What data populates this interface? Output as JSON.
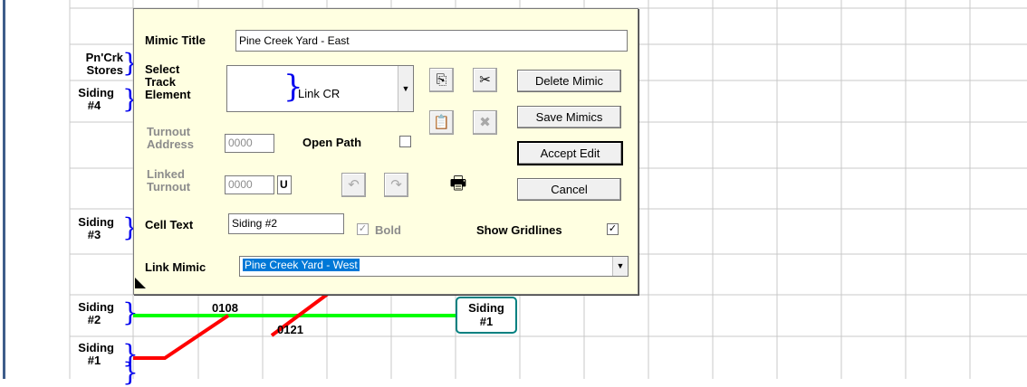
{
  "track_labels": [
    {
      "id": "pn-crk",
      "l1": "Pn'Crk",
      "l2": "Stores"
    },
    {
      "id": "siding4",
      "l1": "Siding",
      "l2": "#4"
    },
    {
      "id": "siding3",
      "l1": "Siding",
      "l2": "#3"
    },
    {
      "id": "siding2",
      "l1": "Siding",
      "l2": "#2"
    },
    {
      "id": "siding1",
      "l1": "Siding",
      "l2": "#1"
    }
  ],
  "addresses": {
    "upper": "0108",
    "lower": "0121"
  },
  "siding1_box": {
    "l1": "Siding",
    "l2": "#1"
  },
  "colors": {
    "track_green": "#00ff00",
    "track_red": "#ff0000",
    "link_brace": "#0000ee",
    "dialog_bg": "#ffffe1",
    "siding_box_border": "#008080"
  },
  "dialog": {
    "mimic_title_label": "Mimic Title",
    "mimic_title_value": "Pine Creek Yard - East",
    "select_label_1": "Select",
    "select_label_2": "Track",
    "select_label_3": "Element",
    "select_value": "Link CR",
    "turnout_label_1": "Turnout",
    "turnout_label_2": "Address",
    "turnout_value": "0000",
    "open_path_label": "Open Path",
    "linked_label_1": "Linked",
    "linked_label_2": "Turnout",
    "linked_value": "0000",
    "linked_suffix": "U",
    "cell_text_label": "Cell Text",
    "cell_text_value": "Siding #2",
    "bold_label": "Bold",
    "show_gridlines_label": "Show Gridlines",
    "link_mimic_label": "Link Mimic",
    "link_mimic_value": "Pine Creek Yard - West",
    "buttons": {
      "delete": "Delete Mimic",
      "save": "Save Mimics",
      "accept": "Accept Edit",
      "cancel": "Cancel"
    },
    "icons": [
      "copy-icon",
      "cut-icon",
      "paste-icon",
      "delete-element-icon",
      "undo-icon",
      "redo-icon",
      "print-icon"
    ]
  }
}
